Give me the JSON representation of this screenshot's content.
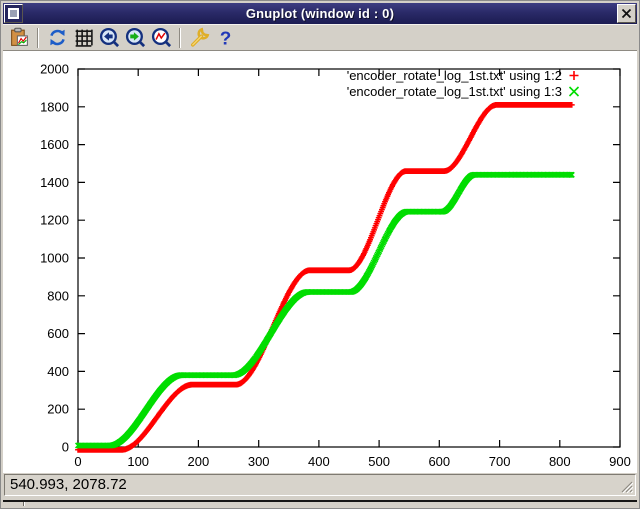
{
  "window": {
    "title": "Gnuplot (window id : 0)"
  },
  "toolbar": {
    "help_glyph": "?",
    "buttons": [
      "copy-plot-to-clipboard",
      "replot",
      "toggle-grid",
      "zoom-previous",
      "zoom-next",
      "unzoom-autoscale",
      "options",
      "help"
    ]
  },
  "statusbar": {
    "coordinates": "540.993, 2078.72"
  },
  "chart_data": {
    "type": "scatter",
    "title": "",
    "xlabel": "",
    "ylabel": "",
    "xlim": [
      0,
      900
    ],
    "ylim": [
      0,
      2000
    ],
    "xticks": [
      0,
      100,
      200,
      300,
      400,
      500,
      600,
      700,
      800,
      900
    ],
    "yticks": [
      0,
      200,
      400,
      600,
      800,
      1000,
      1200,
      1400,
      1600,
      1800,
      2000
    ],
    "grid": false,
    "legend_position": "top-right-inside",
    "sample_step": 1.3,
    "series": [
      {
        "name": "'encoder_rotate_log_1st.txt' using 1:2",
        "marker": "plus",
        "color": "#ff0000",
        "keypoints": [
          [
            0,
            -15
          ],
          [
            72,
            -15
          ],
          [
            190,
            330
          ],
          [
            262,
            330
          ],
          [
            385,
            935
          ],
          [
            450,
            935
          ],
          [
            545,
            1460
          ],
          [
            608,
            1460
          ],
          [
            695,
            1810
          ],
          [
            820,
            1810
          ]
        ]
      },
      {
        "name": "'encoder_rotate_log_1st.txt' using 1:3",
        "marker": "cross",
        "color": "#00dd00",
        "keypoints": [
          [
            0,
            8
          ],
          [
            53,
            8
          ],
          [
            172,
            380
          ],
          [
            258,
            380
          ],
          [
            382,
            820
          ],
          [
            452,
            820
          ],
          [
            547,
            1245
          ],
          [
            605,
            1245
          ],
          [
            658,
            1440
          ],
          [
            820,
            1440
          ]
        ]
      }
    ]
  }
}
